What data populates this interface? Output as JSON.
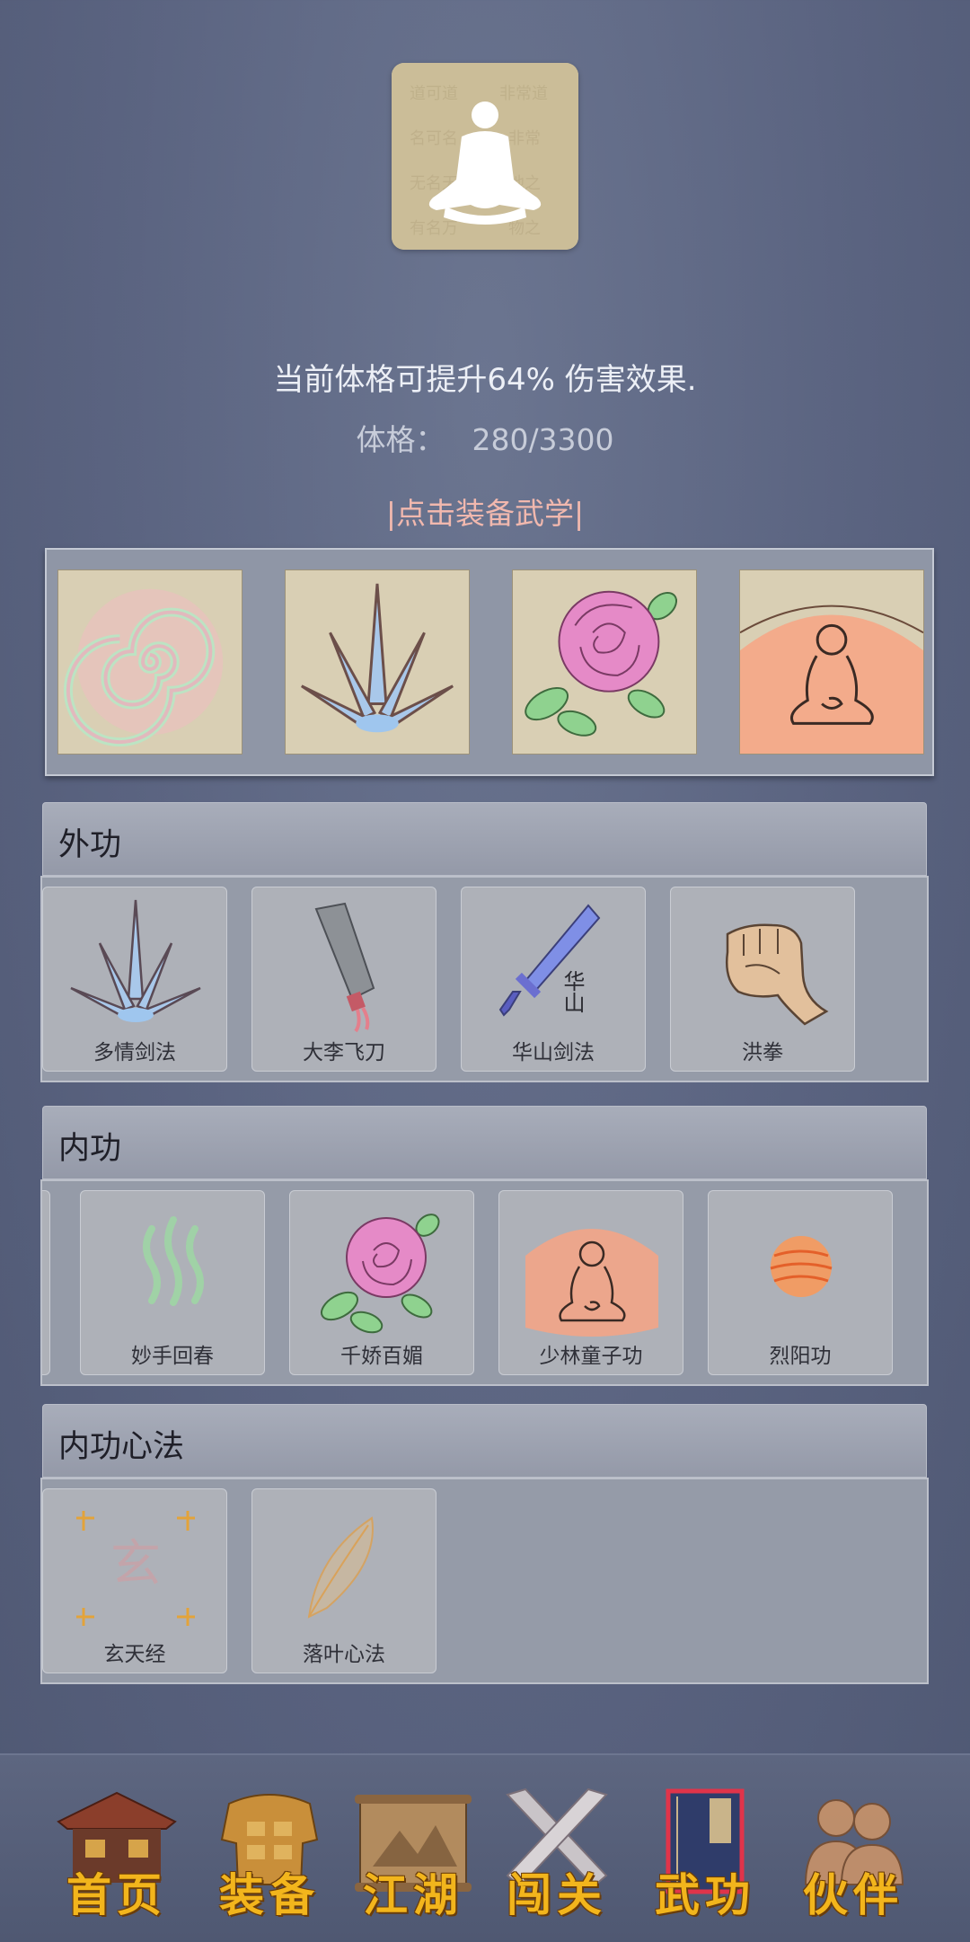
{
  "header": {
    "bonus_text": "当前体格可提升64% 伤害效果.",
    "stat_label": "体格：",
    "stat_value": "280/3300",
    "equip_link": "|点击装备武学|"
  },
  "equipped_slots": [
    {
      "icon": "swirl-icon"
    },
    {
      "icon": "sword-fan-icon"
    },
    {
      "icon": "rose-icon"
    },
    {
      "icon": "meditation-glow-icon"
    }
  ],
  "sections": {
    "waigong": {
      "title": "外功",
      "skills": [
        {
          "label": "多情剑法",
          "icon": "sword-fan-icon"
        },
        {
          "label": "大李飞刀",
          "icon": "cleaver-icon"
        },
        {
          "label": "华山剑法",
          "icon": "sword-icon",
          "icon_text": "华山"
        },
        {
          "label": "洪拳",
          "icon": "fist-icon"
        }
      ]
    },
    "neigong": {
      "title": "内功",
      "skills": [
        {
          "label": "妙手回春",
          "icon": "healing-waves-icon"
        },
        {
          "label": "千娇百媚",
          "icon": "rose-icon"
        },
        {
          "label": "少林童子功",
          "icon": "meditation-glow-icon"
        },
        {
          "label": "烈阳功",
          "icon": "sun-orb-icon"
        }
      ]
    },
    "xinfa": {
      "title": "内功心法",
      "skills": [
        {
          "label": "玄天经",
          "icon": "xuan-seal-icon",
          "icon_text": "玄"
        },
        {
          "label": "落叶心法",
          "icon": "leaf-icon"
        }
      ]
    }
  },
  "nav": [
    {
      "label": "首页",
      "icon": "house-icon"
    },
    {
      "label": "装备",
      "icon": "armor-icon"
    },
    {
      "label": "江湖",
      "icon": "scroll-map-icon"
    },
    {
      "label": "闯关",
      "icon": "crossed-swords-icon"
    },
    {
      "label": "武功",
      "icon": "book-icon",
      "active": true
    },
    {
      "label": "伙伴",
      "icon": "partners-icon"
    }
  ],
  "colors": {
    "background": "#5a6380",
    "link": "#f1b8ae",
    "nav_label": "#f2b51c"
  }
}
